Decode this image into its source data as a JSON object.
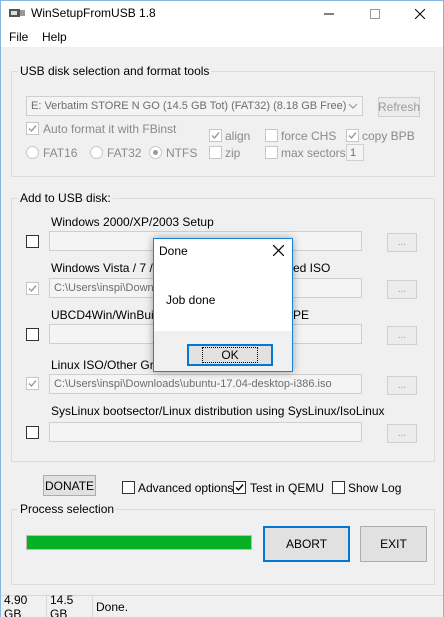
{
  "window": {
    "title": "WinSetupFromUSB 1.8",
    "menu": [
      "File",
      "Help"
    ]
  },
  "usb": {
    "group_title": "USB disk selection and format tools",
    "disk_selected": "E: Verbatim STORE N GO (14.5 GB Tot) (FAT32) (8.18 GB Free)",
    "refresh_label": "Refresh",
    "auto_format_label": "Auto format it with FBinst",
    "auto_format_checked": true,
    "fs_options": [
      "FAT16",
      "FAT32",
      "NTFS"
    ],
    "fs_selected": "NTFS",
    "align_label": "align",
    "align_checked": true,
    "zip_label": "zip",
    "zip_checked": false,
    "force_chs_label": "force CHS",
    "force_chs_checked": false,
    "copy_bpb_label": "copy BPB",
    "copy_bpb_checked": true,
    "max_sectors_label": "max sectors",
    "max_sectors_checked": false,
    "max_sectors_value": "1"
  },
  "add": {
    "group_title": "Add to USB disk:",
    "browse_label": "...",
    "rows": [
      {
        "label": "Windows 2000/XP/2003 Setup",
        "checked": false,
        "path": ""
      },
      {
        "label": "Windows Vista / 7 / 8",
        "label_tail": "ed ISO",
        "checked": true,
        "path": "C:\\Users\\inspi\\Down"
      },
      {
        "label": "UBCD4Win/WinBuild",
        "label_tail": "PE",
        "checked": false,
        "path": ""
      },
      {
        "label": "Linux ISO/Other Grub",
        "checked": true,
        "path": "C:\\Users\\inspi\\Downloads\\ubuntu-17.04-desktop-i386.iso"
      },
      {
        "label": "SysLinux bootsector/Linux distribution using SysLinux/IsoLinux",
        "checked": false,
        "path": ""
      }
    ]
  },
  "options": {
    "donate_label": "DONATE",
    "advanced_label": "Advanced options",
    "advanced_checked": false,
    "qemu_label": "Test in QEMU",
    "qemu_checked": true,
    "showlog_label": "Show Log",
    "showlog_checked": false
  },
  "process": {
    "group_title": "Process selection",
    "progress": 1.0,
    "abort_label": "ABORT",
    "exit_label": "EXIT"
  },
  "status": [
    "4.90 GB",
    "14.5 GB",
    "Done."
  ],
  "dialog": {
    "title": "Done",
    "message": "Job done",
    "ok_label": "OK"
  },
  "colors": {
    "progress_green": "#06b025",
    "dialog_border": "#1883d7",
    "focus_blue": "#0078d7"
  }
}
